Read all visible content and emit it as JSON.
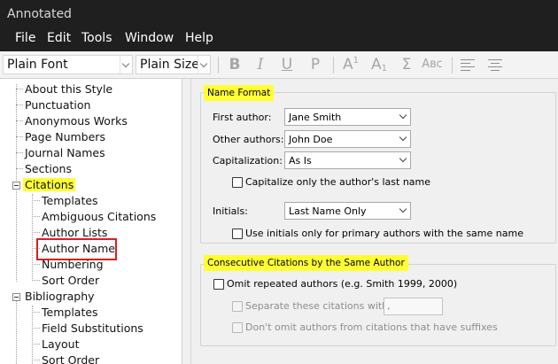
{
  "window": {
    "title": "Annotated"
  },
  "menu": [
    "File",
    "Edit",
    "Tools",
    "Window",
    "Help"
  ],
  "toolbar": {
    "font_value": "Plain Font",
    "size_value": "Plain Size",
    "bold": "B",
    "italic": "I",
    "underline": "U",
    "plain": "P",
    "superscript_base": "A",
    "superscript_mark": "1",
    "subscript_base": "A",
    "subscript_mark": "1",
    "symbol": "Σ",
    "small_caps": "Aʙc"
  },
  "tree": {
    "items": [
      "About this Style",
      "Punctuation",
      "Anonymous Works",
      "Page Numbers",
      "Journal Names",
      "Sections",
      "Citations",
      "Templates",
      "Ambiguous Citations",
      "Author Lists",
      "Author Name",
      "Numbering",
      "Sort Order",
      "Bibliography",
      "Templates",
      "Field Substitutions",
      "Layout",
      "Sort Order"
    ],
    "selected": "Author Name"
  },
  "name_format": {
    "title": "Name Format",
    "first_author_label": "First author:",
    "first_author_value": "Jane Smith",
    "other_authors_label": "Other authors:",
    "other_authors_value": "John Doe",
    "capitalization_label": "Capitalization:",
    "capitalization_value": "As Is",
    "capitalize_last_label": "Capitalize only the author's last name",
    "initials_label": "Initials:",
    "initials_value": "Last Name Only",
    "use_initials_label": "Use initials only for primary authors with the same name"
  },
  "consecutive": {
    "title": "Consecutive Citations by the Same Author",
    "omit_label": "Omit repeated authors (e.g. Smith 1999, 2000)",
    "separate_label": "Separate these citations with:",
    "separator_value": ", ",
    "dont_omit_label": "Don't omit authors from citations that have suffixes"
  }
}
